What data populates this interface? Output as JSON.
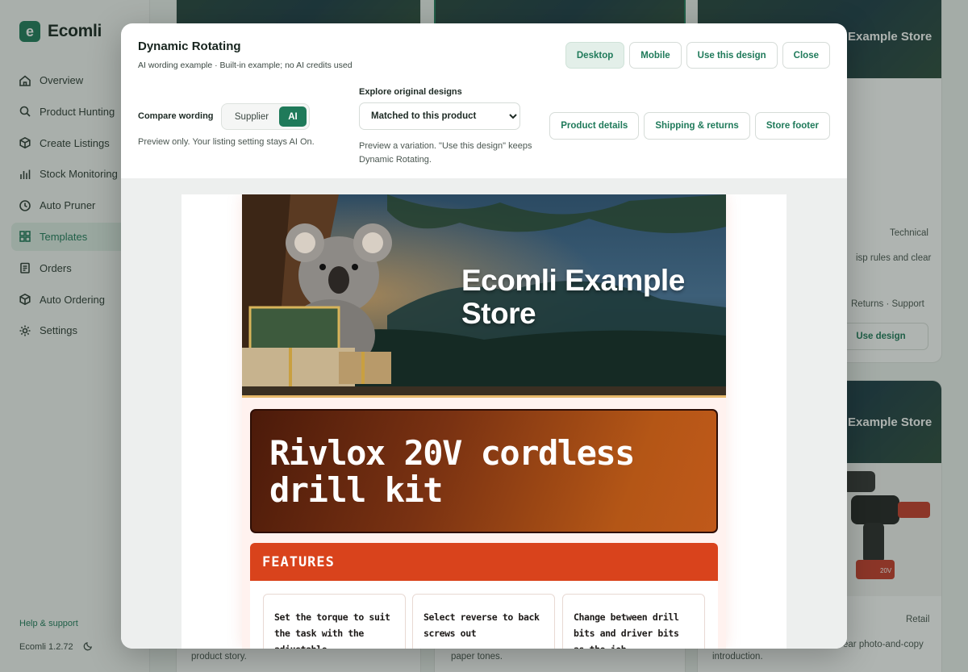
{
  "app": {
    "brand_letter": "e",
    "brand_name": "Ecomli",
    "version": "Ecomli 1.2.72",
    "help_link": "Help & support",
    "accent_color": "#1f7a5a"
  },
  "sidebar": {
    "items": [
      {
        "label": "Overview",
        "icon": "home-icon"
      },
      {
        "label": "Product Hunting",
        "icon": "search-icon"
      },
      {
        "label": "Create Listings",
        "icon": "box-icon"
      },
      {
        "label": "Stock Monitoring",
        "icon": "bar-chart-icon"
      },
      {
        "label": "Auto Pruner",
        "icon": "clock-icon"
      },
      {
        "label": "Templates",
        "icon": "grid-icon",
        "active": true
      },
      {
        "label": "Orders",
        "icon": "clipboard-icon"
      },
      {
        "label": "Auto Ordering",
        "icon": "cube-icon"
      },
      {
        "label": "Settings",
        "icon": "sun-gear-icon"
      }
    ]
  },
  "background": {
    "card1": {
      "hero_text": "Example Store",
      "tag": "Technical",
      "snippet": "isp rules and clear",
      "links": "Returns · Support",
      "button": "Use design"
    },
    "card2": {
      "hero_text": "Example Store",
      "tag": "Retail",
      "snippet": "ear photo-and-copy",
      "foot": "introduction."
    },
    "bottom_left": "product story.",
    "bottom_mid": "paper tones.",
    "drill_badge": "20V"
  },
  "modal": {
    "title": "Dynamic Rotating",
    "subtitle": "AI wording example · Built-in example; no AI credits used",
    "top_buttons": {
      "desktop": "Desktop",
      "mobile": "Mobile",
      "use": "Use this design",
      "close": "Close"
    },
    "compare": {
      "label": "Compare wording",
      "supplier": "Supplier",
      "ai": "AI",
      "note": "Preview only. Your listing setting stays AI On."
    },
    "explore": {
      "label": "Explore original designs",
      "selected": "Matched to this product",
      "note": "Preview a variation. \"Use this design\" keeps Dynamic Rotating."
    },
    "section_buttons": {
      "details": "Product details",
      "shipping": "Shipping & returns",
      "footer": "Store footer"
    }
  },
  "template": {
    "store_name": "Ecomli Example Store",
    "product_title": "Rivlox 20V cordless drill kit",
    "features_heading": "FEATURES",
    "features": [
      "Set the torque to suit the task with the adjustable",
      "Select reverse to back screws out",
      "Change between drill bits and driver bits as the job"
    ]
  }
}
